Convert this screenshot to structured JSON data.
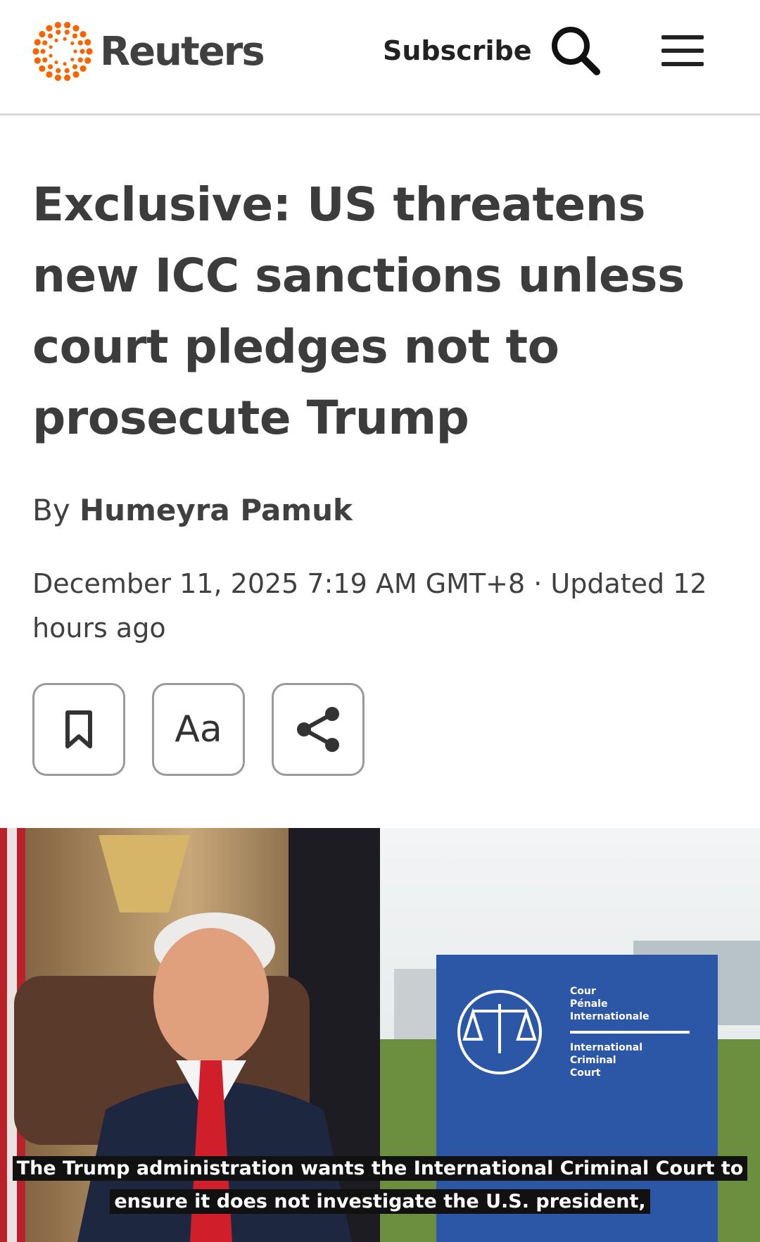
{
  "header": {
    "brand": "Reuters",
    "subscribe_label": "Subscribe",
    "search_icon": "search-icon",
    "menu_icon": "hamburger-menu-icon",
    "brand_color": "#fa6400"
  },
  "article": {
    "headline": "Exclusive: US threatens new ICC sanctions unless court pledges not to prosecute Trump",
    "byline_prefix": "By",
    "author": "Humeyra Pamuk",
    "dateline": "December 11, 2025 7:19 AM GMT+8 · Updated 12 hours ago",
    "tools": {
      "bookmark_icon": "bookmark-icon",
      "text_size_label": "Aa",
      "share_icon": "share-icon"
    }
  },
  "video": {
    "sign_text": [
      "Cour",
      "Pénale",
      "Internationale",
      "International",
      "Criminal",
      "Court"
    ],
    "caption_line1": "The Trump administration wants the International Criminal Court to",
    "caption_line2": "ensure it does not investigate the U.S. president,"
  }
}
